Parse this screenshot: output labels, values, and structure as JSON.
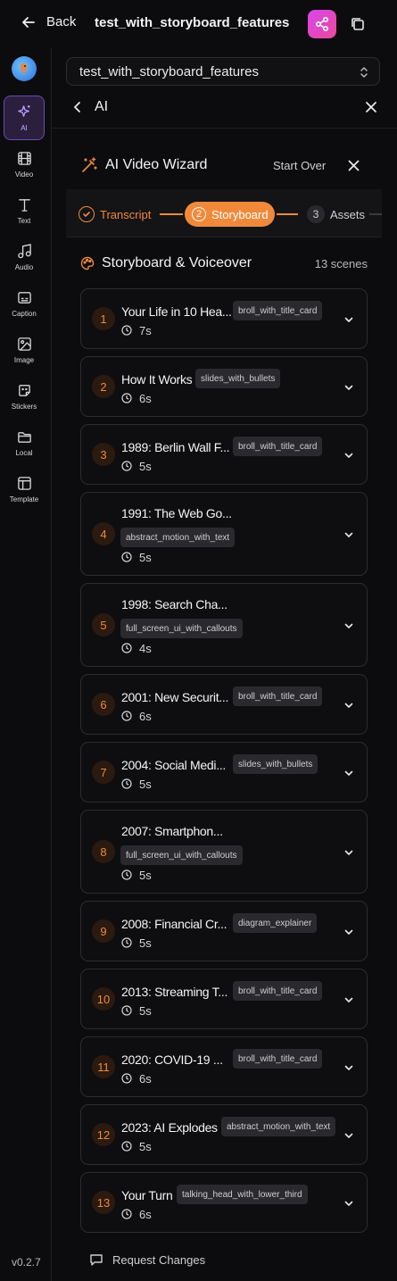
{
  "header": {
    "back_label": "Back",
    "project_title": "test_with_storyboard_features"
  },
  "sidebar": {
    "items": [
      {
        "label": "AI",
        "icon": "sparkles-icon",
        "active": true
      },
      {
        "label": "Video",
        "icon": "film-icon"
      },
      {
        "label": "Text",
        "icon": "text-icon"
      },
      {
        "label": "Audio",
        "icon": "music-icon"
      },
      {
        "label": "Caption",
        "icon": "caption-icon"
      },
      {
        "label": "Image",
        "icon": "image-icon"
      },
      {
        "label": "Stickers",
        "icon": "sticker-icon"
      },
      {
        "label": "Local",
        "icon": "folder-icon"
      },
      {
        "label": "Template",
        "icon": "template-icon"
      }
    ],
    "version": "v0.2.7"
  },
  "panel": {
    "project_select_value": "test_with_storyboard_features",
    "title": "AI"
  },
  "wizard": {
    "title": "AI Video Wizard",
    "start_over_label": "Start Over",
    "steps": [
      {
        "number": "1",
        "label": "Transcript",
        "state": "done"
      },
      {
        "number": "2",
        "label": "Storyboard",
        "state": "active"
      },
      {
        "number": "3",
        "label": "Assets",
        "state": "pending"
      }
    ]
  },
  "storyboard": {
    "title": "Storyboard & Voiceover",
    "count_label": "13 scenes",
    "scenes": [
      {
        "num": "1",
        "title": "Your Life in 10 Hea...",
        "tag": "broll_with_title_card",
        "duration": "7s"
      },
      {
        "num": "2",
        "title": "How It Works",
        "tag": "slides_with_bullets",
        "duration": "6s"
      },
      {
        "num": "3",
        "title": "1989: Berlin Wall F...",
        "tag": "broll_with_title_card",
        "duration": "5s"
      },
      {
        "num": "4",
        "title": "1991: The Web Go...",
        "tag": "abstract_motion_with_text",
        "duration": "5s"
      },
      {
        "num": "5",
        "title": "1998: Search Cha...",
        "tag": "full_screen_ui_with_callouts",
        "duration": "4s"
      },
      {
        "num": "6",
        "title": "2001: New Securit...",
        "tag": "broll_with_title_card",
        "duration": "6s"
      },
      {
        "num": "7",
        "title": "2004: Social Medi...",
        "tag": "slides_with_bullets",
        "duration": "5s"
      },
      {
        "num": "8",
        "title": "2007: Smartphon...",
        "tag": "full_screen_ui_with_callouts",
        "duration": "5s"
      },
      {
        "num": "9",
        "title": "2008: Financial Cr...",
        "tag": "diagram_explainer",
        "duration": "5s"
      },
      {
        "num": "10",
        "title": "2013: Streaming T...",
        "tag": "broll_with_title_card",
        "duration": "5s"
      },
      {
        "num": "11",
        "title": "2020: COVID-19 ...",
        "tag": "broll_with_title_card",
        "duration": "6s"
      },
      {
        "num": "12",
        "title": "2023: AI Explodes",
        "tag": "abstract_motion_with_text",
        "duration": "5s"
      },
      {
        "num": "13",
        "title": "Your Turn",
        "tag": "talking_head_with_lower_third",
        "duration": "6s"
      }
    ]
  },
  "footer": {
    "request_changes_label": "Request Changes"
  },
  "colors": {
    "accent": "#f08a3a",
    "share_gradient": "#d946ef",
    "active_rail": "#2a1f3d"
  }
}
